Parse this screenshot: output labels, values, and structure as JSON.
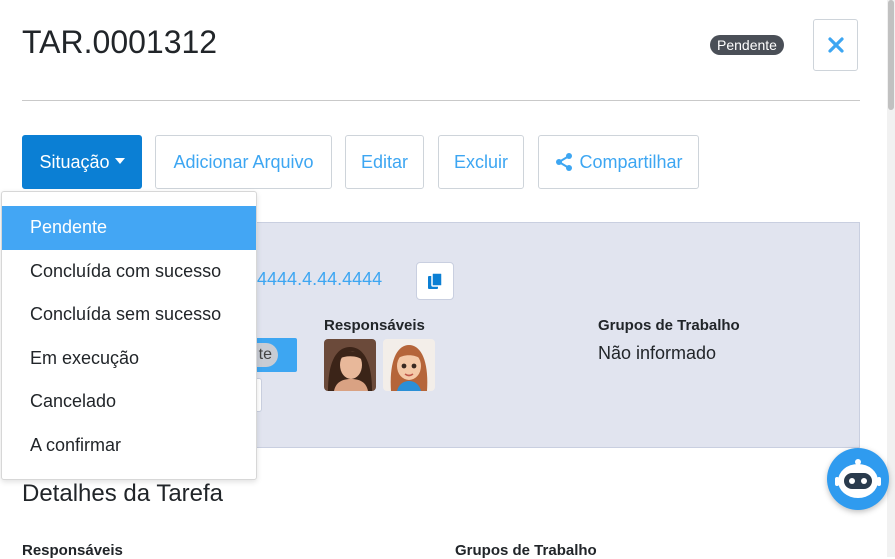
{
  "task": {
    "title": "TAR.0001312",
    "status_badge": "Pendente"
  },
  "toolbar": {
    "situacao_label": "Situação",
    "adicionar_label": "Adicionar Arquivo",
    "editar_label": "Editar",
    "excluir_label": "Excluir",
    "compartilhar_label": "Compartilhar"
  },
  "dropdown": {
    "items": [
      {
        "label": "Pendente",
        "active": true
      },
      {
        "label": "Concluída com sucesso"
      },
      {
        "label": "Concluída sem sucesso"
      },
      {
        "label": "Em execução"
      },
      {
        "label": "Cancelado"
      },
      {
        "label": "A confirmar"
      }
    ]
  },
  "info": {
    "code_visible": "44.4444.4.44.4444",
    "status_pill_partial": "te",
    "responsaveis_label": "Responsáveis",
    "grupos_label": "Grupos de Trabalho",
    "grupos_value": "Não informado"
  },
  "details": {
    "title": "Detalhes da Tarefa",
    "responsaveis_label": "Responsáveis",
    "grupos_label": "Grupos de Trabalho"
  },
  "colors": {
    "primary": "#0b7fd4",
    "link": "#3da6f2",
    "active_item": "#43a6f4",
    "badge": "#4a4f57",
    "panel_bg": "#e1e4ef"
  },
  "icons": [
    "close-icon",
    "caret-down-icon",
    "share-icon",
    "copy-icon",
    "chatbot-icon"
  ]
}
